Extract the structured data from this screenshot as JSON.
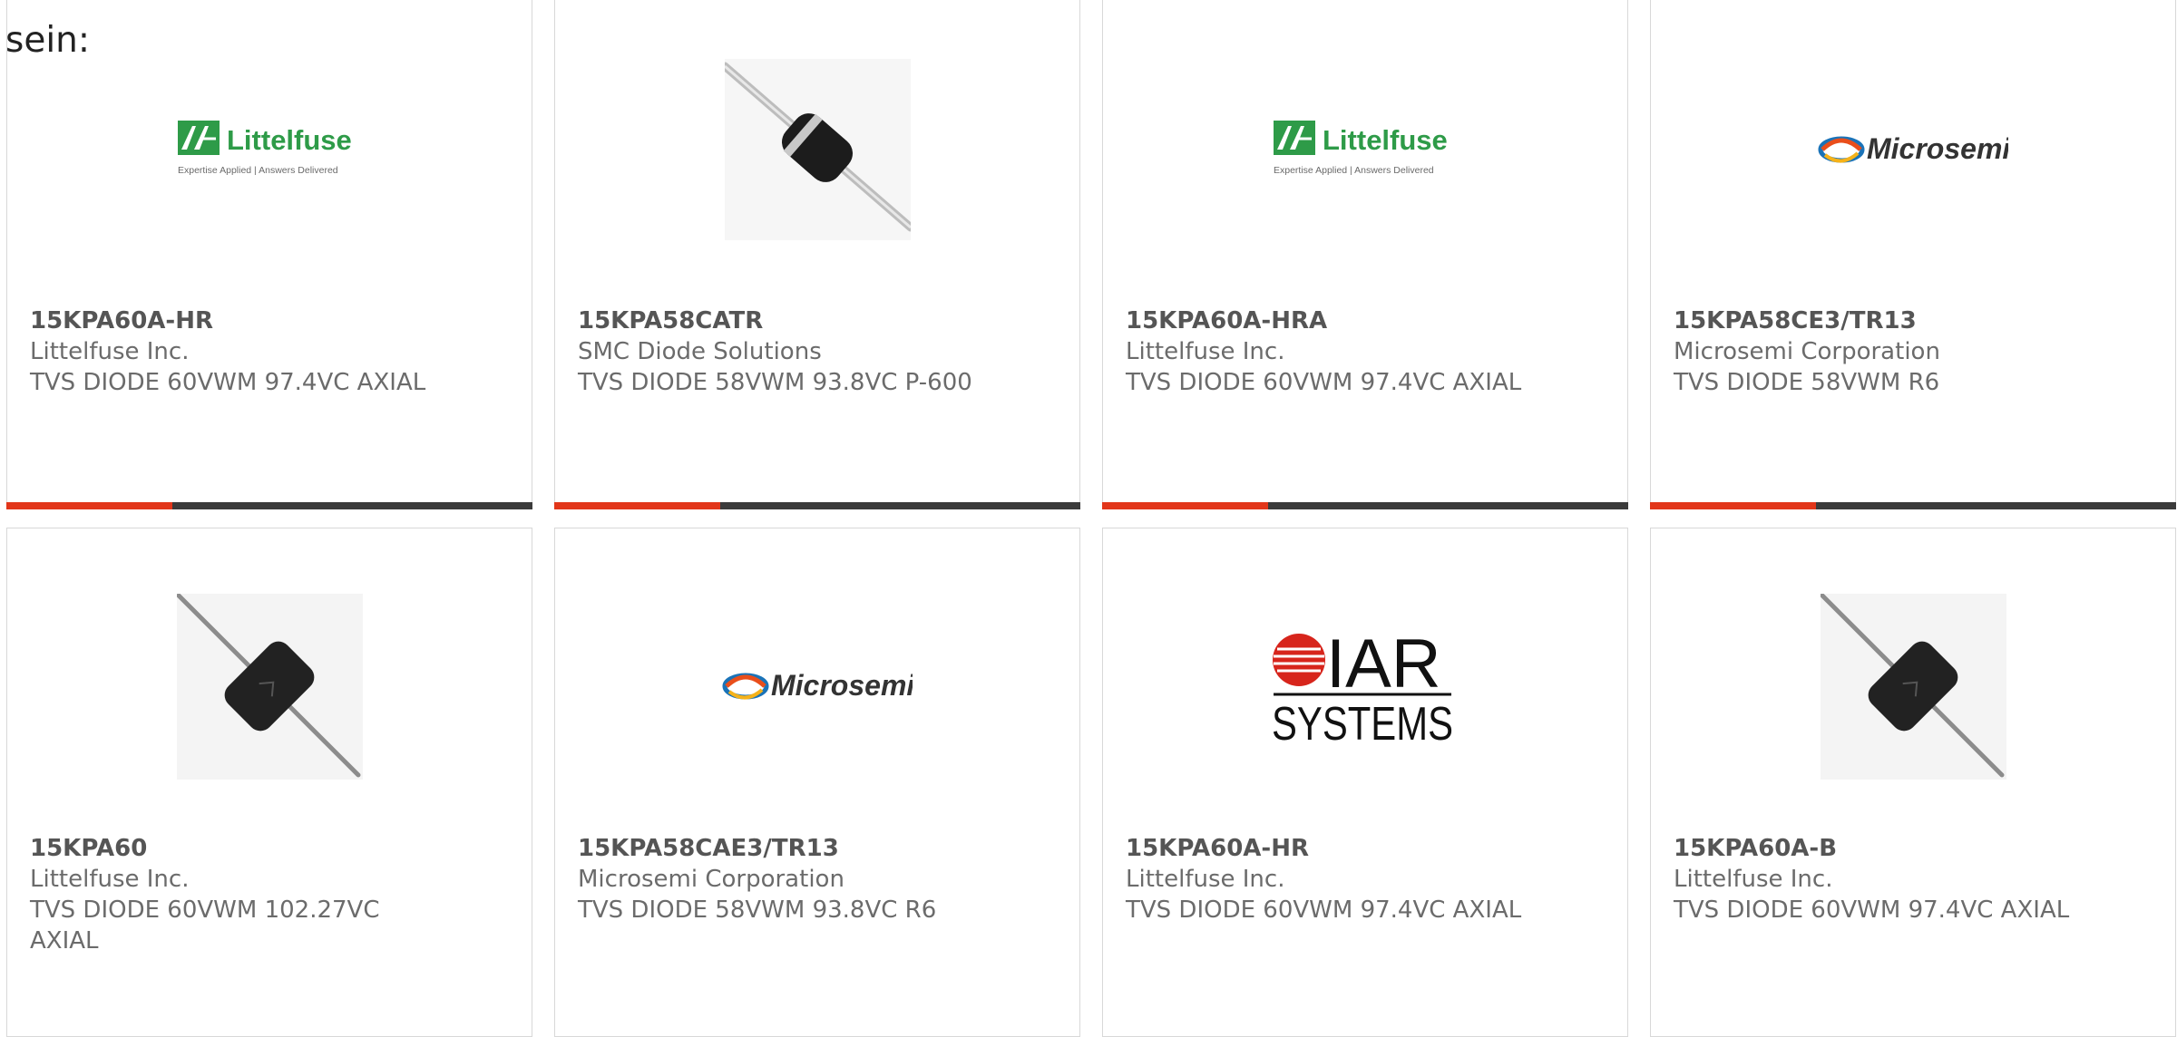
{
  "intro_text": "sein:",
  "colors": {
    "accent": "#e2361a",
    "bar": "#3b3b3b"
  },
  "products": [
    {
      "part": "15KPA60A-HR",
      "manufacturer": "Littelfuse Inc.",
      "description": "TVS DIODE 60VWM 97.4VC AXIAL",
      "image": "littelfuse-logo",
      "logo_text": "Littelfuse",
      "tagline": "Expertise Applied | Answers Delivered"
    },
    {
      "part": "15KPA58CATR",
      "manufacturer": "SMC Diode Solutions",
      "description": "TVS DIODE 58VWM 93.8VC P-600",
      "image": "axial-diode-photo"
    },
    {
      "part": "15KPA60A-HRA",
      "manufacturer": "Littelfuse Inc.",
      "description": "TVS DIODE 60VWM 97.4VC AXIAL",
      "image": "littelfuse-logo",
      "logo_text": "Littelfuse",
      "tagline": "Expertise Applied | Answers Delivered"
    },
    {
      "part": "15KPA58CE3/TR13",
      "manufacturer": "Microsemi Corporation",
      "description": "TVS DIODE 58VWM R6",
      "image": "microsemi-logo",
      "logo_text": "Microsemi"
    },
    {
      "part": "15KPA60",
      "manufacturer": "Littelfuse Inc.",
      "description": "TVS DIODE 60VWM 102.27VC AXIAL",
      "image": "p600-diode-photo"
    },
    {
      "part": "15KPA58CAE3/TR13",
      "manufacturer": "Microsemi Corporation",
      "description": "TVS DIODE 58VWM 93.8VC R6",
      "image": "microsemi-logo",
      "logo_text": "Microsemi"
    },
    {
      "part": "15KPA60A-HR",
      "manufacturer": "Littelfuse Inc.",
      "description": "TVS DIODE 60VWM 97.4VC AXIAL",
      "image": "iar-systems-logo",
      "logo_text": "IAR",
      "logo_subtext": "SYSTEMS"
    },
    {
      "part": "15KPA60A-B",
      "manufacturer": "Littelfuse Inc.",
      "description": "TVS DIODE 60VWM 97.4VC AXIAL",
      "image": "p600-diode-photo"
    }
  ]
}
